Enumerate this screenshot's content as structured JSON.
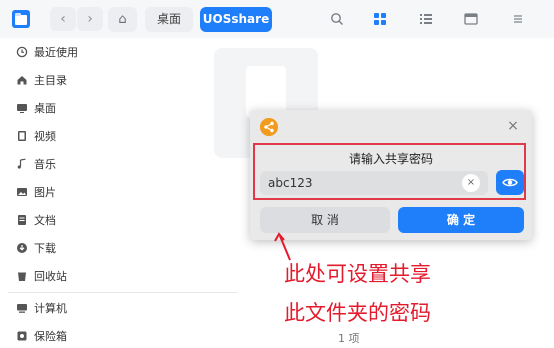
{
  "toolbar": {
    "back_label": "‹",
    "forward_label": "›",
    "home_glyph": "⌂",
    "breadcrumbs": [
      "桌面",
      "UOSshare"
    ],
    "icons": [
      "search-icon",
      "icon-view-icon",
      "list-view-icon",
      "details-panel-icon",
      "menu-icon"
    ]
  },
  "sidebar": {
    "items": [
      {
        "label": "最近使用",
        "icon": "clock-icon"
      },
      {
        "label": "主目录",
        "icon": "home-icon"
      },
      {
        "label": "桌面",
        "icon": "desktop-icon"
      },
      {
        "label": "视频",
        "icon": "video-icon"
      },
      {
        "label": "音乐",
        "icon": "music-icon"
      },
      {
        "label": "图片",
        "icon": "picture-icon"
      },
      {
        "label": "文档",
        "icon": "document-icon"
      },
      {
        "label": "下载",
        "icon": "download-icon"
      },
      {
        "label": "回收站",
        "icon": "trash-icon"
      },
      {
        "label": "计算机",
        "icon": "computer-icon"
      },
      {
        "label": "保险箱",
        "icon": "safe-icon"
      }
    ]
  },
  "status": {
    "count": "1 项"
  },
  "dialog": {
    "title": "请输入共享密码",
    "password_value": "abc123",
    "clear_glyph": "×",
    "close_glyph": "×",
    "cancel_label": "取 消",
    "confirm_label": "确 定"
  },
  "annotation": {
    "line1": "此处可设置共享",
    "line2": "此文件夹的密码"
  },
  "colors": {
    "accent": "#1f7ffa",
    "annotation_red": "#e31b2c",
    "share_orange": "#f29c1f"
  }
}
